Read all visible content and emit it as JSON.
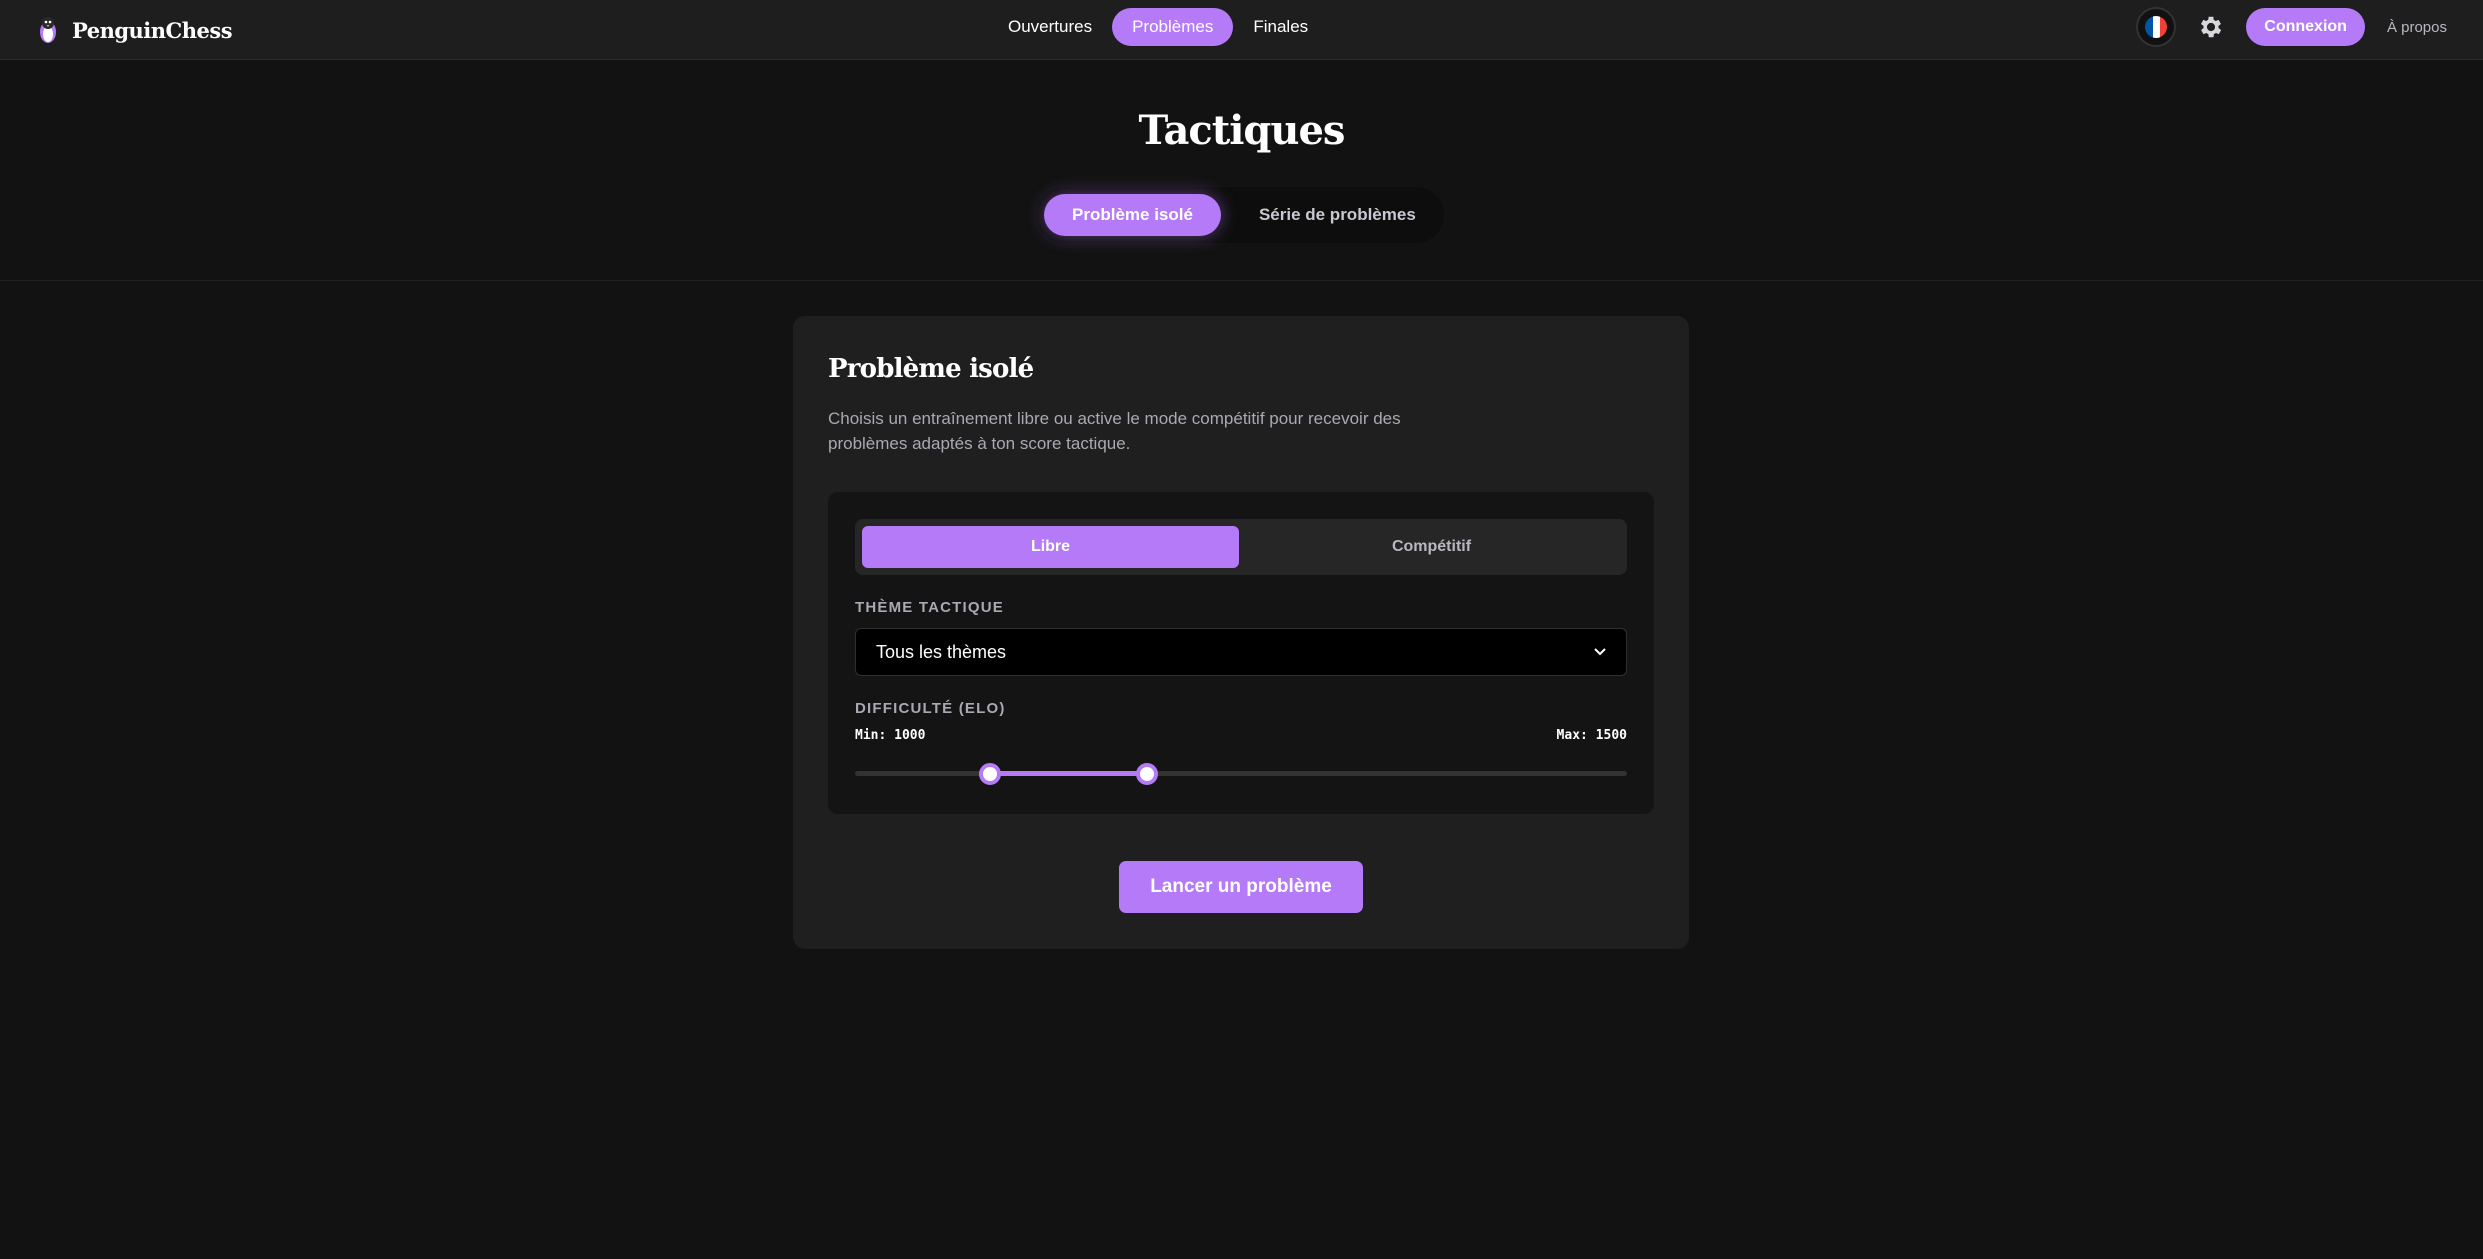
{
  "header": {
    "brand": "PenguinChess",
    "nav": [
      {
        "label": "Ouvertures",
        "active": false
      },
      {
        "label": "Problèmes",
        "active": true
      },
      {
        "label": "Finales",
        "active": false
      }
    ],
    "language_flag": "france-flag-icon",
    "settings_icon": "gear-icon",
    "login_label": "Connexion",
    "about_label": "À propos"
  },
  "hero": {
    "title": "Tactiques",
    "tabs": [
      {
        "label": "Problème isolé",
        "active": true
      },
      {
        "label": "Série de problèmes",
        "active": false
      }
    ]
  },
  "card": {
    "title": "Problème isolé",
    "description": "Choisis un entraînement libre ou active le mode compétitif pour recevoir des problèmes adaptés à ton score tactique.",
    "modes": [
      {
        "label": "Libre",
        "active": true
      },
      {
        "label": "Compétitif",
        "active": false
      }
    ],
    "theme": {
      "label": "Thème tactique",
      "selected": "Tous les thèmes"
    },
    "difficulty": {
      "label": "Difficulté (ELO)",
      "min_text": "Min: 1000",
      "max_text": "Max: 1500",
      "min_fraction": 0.175,
      "max_fraction": 0.378
    },
    "launch_label": "Lancer un problème"
  },
  "colors": {
    "accent": "#b57af7",
    "background": "#121212",
    "surface": "#1f1f1f"
  }
}
